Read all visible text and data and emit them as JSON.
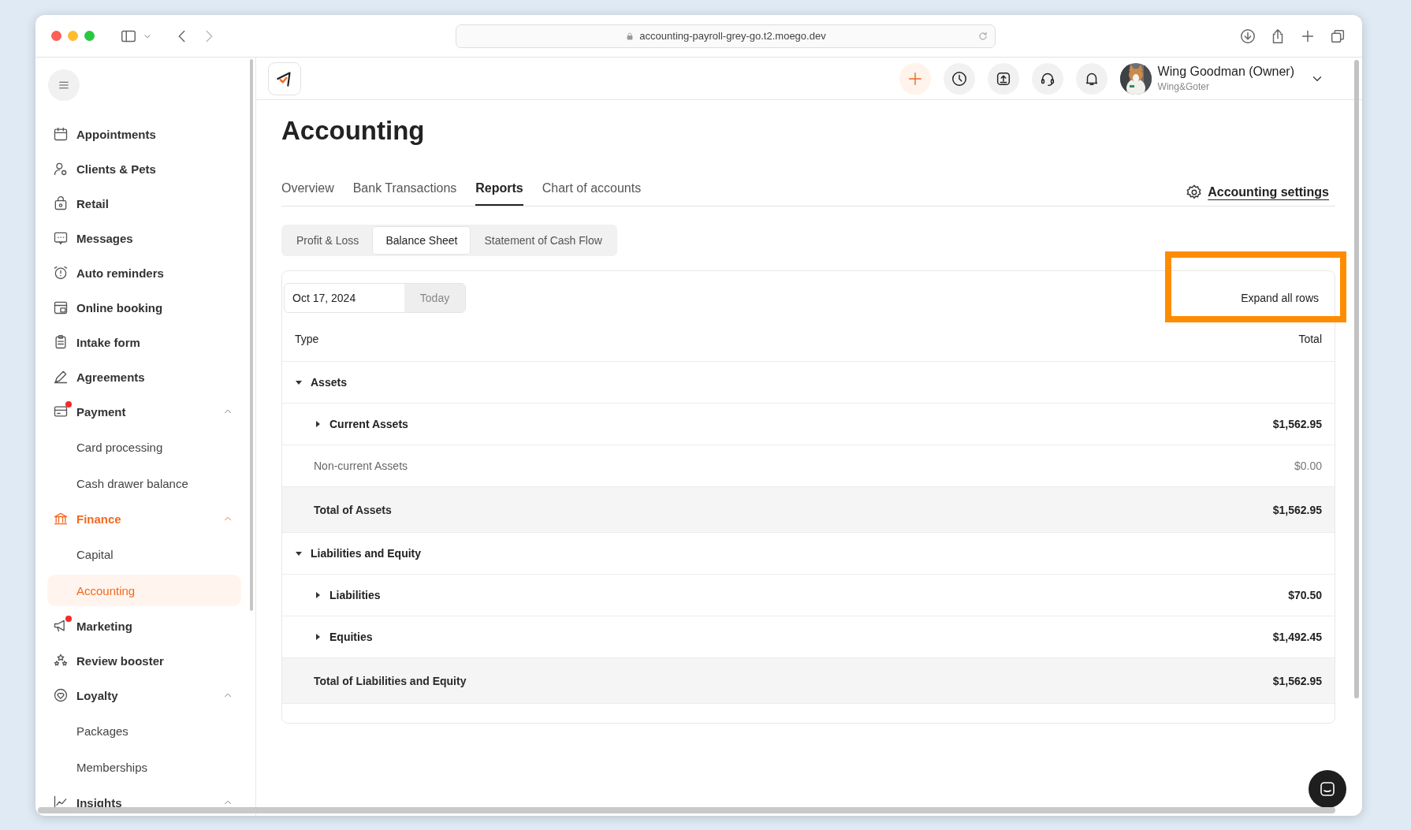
{
  "browser": {
    "url": "accounting-payroll-grey-go.t2.moego.dev"
  },
  "sidebar": {
    "items": [
      {
        "label": "Appointments",
        "kind": "main",
        "selected": false
      },
      {
        "label": "Clients & Pets",
        "kind": "main",
        "selected": false
      },
      {
        "label": "Retail",
        "kind": "main",
        "selected": false
      },
      {
        "label": "Messages",
        "kind": "main",
        "selected": false
      },
      {
        "label": "Auto reminders",
        "kind": "main",
        "selected": false
      },
      {
        "label": "Online booking",
        "kind": "main",
        "selected": false
      },
      {
        "label": "Intake form",
        "kind": "main",
        "selected": false
      },
      {
        "label": "Agreements",
        "kind": "main",
        "selected": false
      },
      {
        "label": "Payment",
        "kind": "main",
        "selected": false,
        "badge": true,
        "expanded": true
      },
      {
        "label": "Card processing",
        "kind": "sub",
        "selected": false
      },
      {
        "label": "Cash drawer balance",
        "kind": "sub",
        "selected": false
      },
      {
        "label": "Finance",
        "kind": "main",
        "selected": true,
        "expanded": true
      },
      {
        "label": "Capital",
        "kind": "sub",
        "selected": false
      },
      {
        "label": "Accounting",
        "kind": "sub",
        "selected": true
      },
      {
        "label": "Marketing",
        "kind": "main",
        "selected": false,
        "badge": true
      },
      {
        "label": "Review booster",
        "kind": "main",
        "selected": false
      },
      {
        "label": "Loyalty",
        "kind": "main",
        "selected": false,
        "expanded": true
      },
      {
        "label": "Packages",
        "kind": "sub",
        "selected": false
      },
      {
        "label": "Memberships",
        "kind": "sub",
        "selected": false
      },
      {
        "label": "Insights",
        "kind": "main",
        "selected": false,
        "expanded": true
      }
    ]
  },
  "user": {
    "name": "Wing Goodman (Owner)",
    "business": "Wing&Goter"
  },
  "page": {
    "title": "Accounting",
    "tabs": [
      {
        "label": "Overview",
        "selected": false
      },
      {
        "label": "Bank Transactions",
        "selected": false
      },
      {
        "label": "Reports",
        "selected": true
      },
      {
        "label": "Chart of accounts",
        "selected": false
      }
    ],
    "settings_link": "Accounting settings",
    "report_tabs": [
      {
        "label": "Profit & Loss",
        "selected": false
      },
      {
        "label": "Balance Sheet",
        "selected": true
      },
      {
        "label": "Statement of Cash Flow",
        "selected": false
      }
    ],
    "date": "Oct 17, 2024",
    "today_button": "Today",
    "expand_button": {
      "label": "Expand all rows",
      "highlighted": true
    }
  },
  "table": {
    "columns": [
      "Type",
      "Total"
    ],
    "rows": [
      {
        "kind": "group",
        "label": "Assets",
        "expanded": true
      },
      {
        "kind": "subgroup",
        "label": "Current Assets",
        "total": "$1,562.95",
        "expanded": false
      },
      {
        "kind": "plain",
        "label": "Non-current Assets",
        "total": "$0.00"
      },
      {
        "kind": "total",
        "label": "Total of Assets",
        "total": "$1,562.95"
      },
      {
        "kind": "group",
        "label": "Liabilities and Equity",
        "expanded": true
      },
      {
        "kind": "subgroup",
        "label": "Liabilities",
        "total": "$70.50",
        "expanded": false
      },
      {
        "kind": "subgroup",
        "label": "Equities",
        "total": "$1,492.45",
        "expanded": false
      },
      {
        "kind": "total",
        "label": "Total of Liabilities and Equity",
        "total": "$1,562.95"
      }
    ]
  }
}
